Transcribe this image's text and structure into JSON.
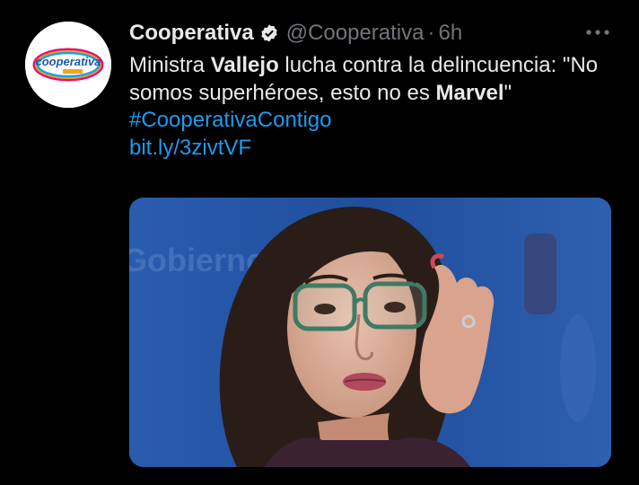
{
  "tweet": {
    "author_name": "Cooperativa",
    "handle": "@Cooperativa",
    "separator": "·",
    "time": "6h",
    "more_label": "···",
    "avatar_text": "cooperativa",
    "text": {
      "p1": "Ministra ",
      "b1": "Vallejo",
      "p2": " lucha contra la delincuencia: \"No somos superhéroes, esto no es ",
      "b2": "Marvel",
      "p3": "\" ",
      "hashtag": "#CooperativaContigo",
      "url": "bit.ly/3zivtVF"
    },
    "media_background_text": "Gobierno"
  },
  "colors": {
    "background": "#000000",
    "text": "#e7e9ea",
    "secondary": "#71767b",
    "link": "#1d9bf0",
    "media_blue": "#1f4e9c"
  },
  "icons": {
    "verified": "verified-badge-icon",
    "more": "more-dots-icon"
  }
}
